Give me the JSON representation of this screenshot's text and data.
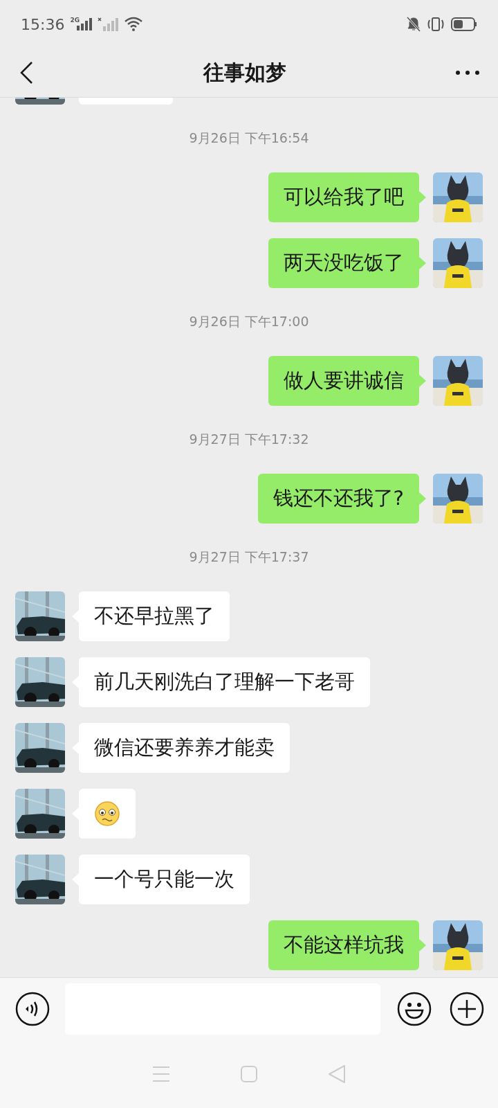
{
  "status_bar": {
    "time": "15:36",
    "network": "2G"
  },
  "header": {
    "title": "往事如梦"
  },
  "messages": [
    {
      "kind": "partial"
    },
    {
      "kind": "time",
      "text": "9月26日 下午16:54"
    },
    {
      "kind": "sent",
      "text": "可以给我了吧"
    },
    {
      "kind": "sent",
      "text": "两天没吃饭了"
    },
    {
      "kind": "time",
      "text": "9月26日 下午17:00"
    },
    {
      "kind": "sent",
      "text": "做人要讲诚信"
    },
    {
      "kind": "time",
      "text": "9月27日 下午17:32"
    },
    {
      "kind": "sent",
      "text": "钱还不还我了?"
    },
    {
      "kind": "time",
      "text": "9月27日 下午17:37"
    },
    {
      "kind": "received",
      "text": "不还早拉黑了"
    },
    {
      "kind": "received",
      "text": "前几天刚洗白了理解一下老哥"
    },
    {
      "kind": "received",
      "text": "微信还要养养才能卖"
    },
    {
      "kind": "sticker"
    },
    {
      "kind": "received",
      "text": "一个号只能一次"
    },
    {
      "kind": "sent",
      "text": "不能这样坑我"
    }
  ]
}
